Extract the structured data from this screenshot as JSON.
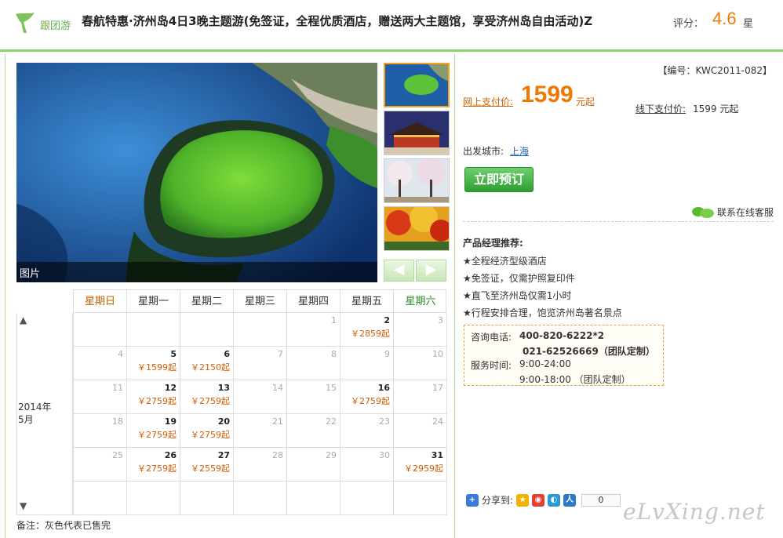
{
  "header": {
    "logo_text": "跟团游",
    "title": "春航特惠·济州岛4日3晚主题游(免签证，全程优质酒店，赠送两大主题馆，享受济州岛自由活动)Z",
    "score_label": "评分：",
    "score_value": "4.6",
    "score_unit": "星"
  },
  "gallery": {
    "caption": "图片",
    "prev_label": "◀",
    "next_label": "▶"
  },
  "calendar": {
    "up_arrow": "▲",
    "down_arrow": "▼",
    "year": "2014年",
    "month": "5月",
    "weekdays": [
      "星期日",
      "星期一",
      "星期二",
      "星期三",
      "星期四",
      "星期五",
      "星期六"
    ],
    "cells": [
      {
        "d": "",
        "p": ""
      },
      {
        "d": "",
        "p": ""
      },
      {
        "d": "",
        "p": ""
      },
      {
        "d": "",
        "p": ""
      },
      {
        "d": "1",
        "p": ""
      },
      {
        "d": "2",
        "p": "￥2859起",
        "on": true
      },
      {
        "d": "3",
        "p": ""
      },
      {
        "d": "4",
        "p": ""
      },
      {
        "d": "5",
        "p": "￥1599起",
        "on": true
      },
      {
        "d": "6",
        "p": "￥2150起",
        "on": true
      },
      {
        "d": "7",
        "p": ""
      },
      {
        "d": "8",
        "p": ""
      },
      {
        "d": "9",
        "p": ""
      },
      {
        "d": "10",
        "p": ""
      },
      {
        "d": "11",
        "p": ""
      },
      {
        "d": "12",
        "p": "￥2759起",
        "on": true
      },
      {
        "d": "13",
        "p": "￥2759起",
        "on": true
      },
      {
        "d": "14",
        "p": ""
      },
      {
        "d": "15",
        "p": ""
      },
      {
        "d": "16",
        "p": "￥2759起",
        "on": true
      },
      {
        "d": "17",
        "p": ""
      },
      {
        "d": "18",
        "p": ""
      },
      {
        "d": "19",
        "p": "￥2759起",
        "on": true
      },
      {
        "d": "20",
        "p": "￥2759起",
        "on": true
      },
      {
        "d": "21",
        "p": ""
      },
      {
        "d": "22",
        "p": ""
      },
      {
        "d": "23",
        "p": ""
      },
      {
        "d": "24",
        "p": ""
      },
      {
        "d": "25",
        "p": ""
      },
      {
        "d": "26",
        "p": "￥2759起",
        "on": true
      },
      {
        "d": "27",
        "p": "￥2559起",
        "on": true
      },
      {
        "d": "28",
        "p": ""
      },
      {
        "d": "29",
        "p": ""
      },
      {
        "d": "30",
        "p": ""
      },
      {
        "d": "31",
        "p": "￥2959起",
        "on": true
      },
      {
        "d": "",
        "p": ""
      },
      {
        "d": "",
        "p": ""
      },
      {
        "d": "",
        "p": ""
      },
      {
        "d": "",
        "p": ""
      },
      {
        "d": "",
        "p": ""
      },
      {
        "d": "",
        "p": ""
      },
      {
        "d": "",
        "p": ""
      }
    ],
    "note": "备注：灰色代表已售完"
  },
  "product": {
    "code": "【编号：KWC2011-082】",
    "online_label": "网上支付价:",
    "online_price": "1599",
    "online_unit": "元起",
    "offline_label": "线下支付价:",
    "offline_value": "1599 元起",
    "departure_label": "出发城市:",
    "departure_city": "上海",
    "book_label": "立即预订",
    "service_label": "联系在线客服"
  },
  "recommend": {
    "title": "产品经理推荐:",
    "items": [
      "★全程经济型级酒店",
      "★免签证，仅需护照复印件",
      "★直飞至济州岛仅需1小时",
      "★行程安排合理，饱览济州岛著名景点"
    ]
  },
  "contact": {
    "phone_label": "咨询电话:",
    "phone1": "400-820-6222*2",
    "phone2": "021-62526669（团队定制）",
    "hours_label": "服务时间:",
    "hours1": "9:00-24:00",
    "hours2": "9:00-18:00 （团队定制）"
  },
  "share": {
    "label": "分享到:",
    "count": "0"
  },
  "watermark": "eLvXing.net",
  "colors": {
    "accent_green": "#8fd16b",
    "price_orange": "#f07800",
    "link_blue": "#1b5fb0"
  }
}
